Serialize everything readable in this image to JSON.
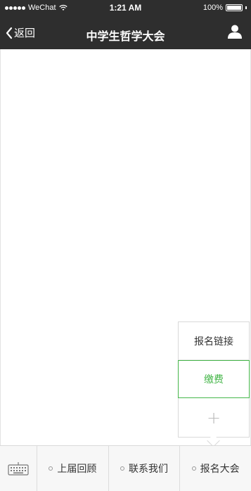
{
  "status_bar": {
    "carrier": "WeChat",
    "time": "1:21 AM",
    "battery_percent": "100%",
    "signal_icon": "signal-dots-icon",
    "wifi_icon": "wifi-icon",
    "battery_icon": "battery-icon"
  },
  "nav": {
    "back_label": "返回",
    "title": "中学生哲学大会",
    "profile_icon": "person-icon"
  },
  "popup": {
    "items": [
      {
        "label": "报名链接",
        "active": false
      },
      {
        "label": "缴费",
        "active": true
      }
    ],
    "add_icon": "+"
  },
  "menu": {
    "keyboard_icon": "keyboard-icon",
    "items": [
      {
        "label": "上届回顾"
      },
      {
        "label": "联系我们"
      },
      {
        "label": "报名大会"
      }
    ]
  },
  "colors": {
    "nav_bg": "#2e2e2e",
    "accent_green": "#45b649",
    "menu_bg": "#f7f7f7"
  }
}
